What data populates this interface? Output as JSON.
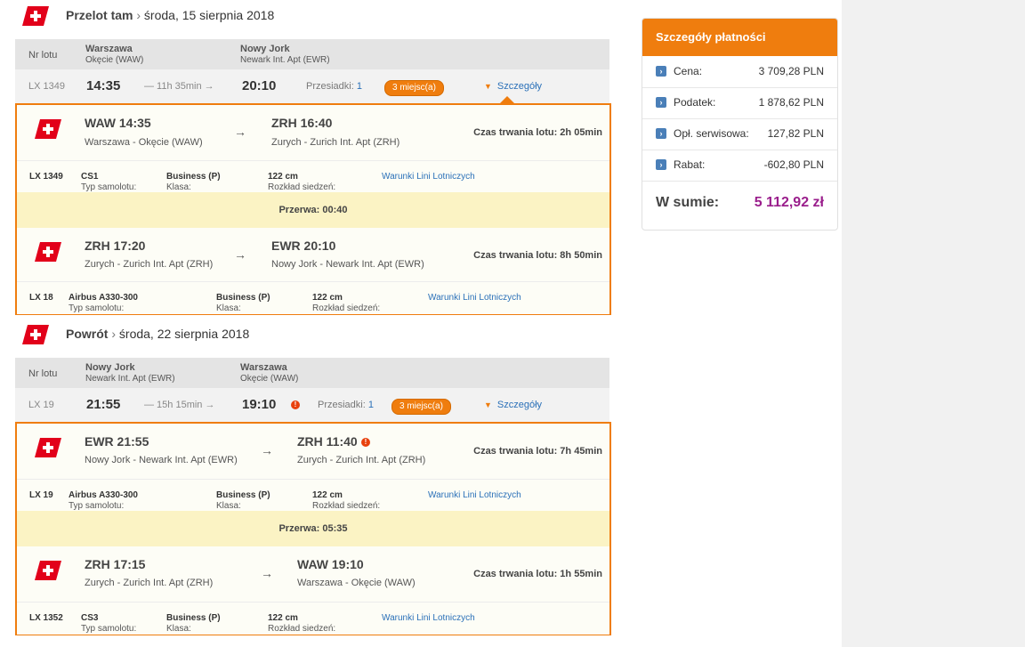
{
  "colors": {
    "accent": "#ef7d0e",
    "link": "#2a70b8",
    "total": "#9a1e8c",
    "break_bg": "#fbf3c4"
  },
  "outbound": {
    "heading": "Przelot tam",
    "date": "środa, 15 sierpnia 2018",
    "table_head": {
      "nr": "Nr lotu",
      "from_city": "Warszawa",
      "from_apt": "Okęcie (WAW)",
      "to_city": "Nowy Jork",
      "to_apt": "Newark Int. Apt (EWR)"
    },
    "summary": {
      "flight": "LX 1349",
      "dep": "14:35",
      "duration": "— 11h 35min →",
      "arr": "20:10",
      "transfers_label": "Przesiadki:",
      "transfers": "1",
      "seats": "3 miejsc(a)",
      "details": "Szczegóły"
    },
    "legs": [
      {
        "from_code": "WAW 14:35",
        "from_place": "Warszawa - Okęcie (WAW)",
        "to_code": "ZRH 16:40",
        "to_place": "Zurych - Zurich Int. Apt (ZRH)",
        "duration": "Czas trwania lotu: 2h 05min",
        "flight": "LX 1349",
        "plane_label": "Typ samolotu:",
        "plane": "CS1",
        "class_label": "Klasa:",
        "class": "Business (P)",
        "seat_label": "Rozkład siedzeń:",
        "seat": "122 cm",
        "terms": "Warunki Lini Lotniczych"
      },
      {
        "from_code": "ZRH 17:20",
        "from_place": "Zurych - Zurich Int. Apt (ZRH)",
        "to_code": "EWR 20:10",
        "to_place": "Nowy Jork - Newark Int. Apt (EWR)",
        "duration": "Czas trwania lotu: 8h 50min",
        "flight": "LX 18",
        "plane_label": "Typ samolotu:",
        "plane": "Airbus A330-300",
        "class_label": "Klasa:",
        "class": "Business (P)",
        "seat_label": "Rozkład siedzeń:",
        "seat": "122 cm",
        "terms": "Warunki Lini Lotniczych"
      }
    ],
    "break": "Przerwa: 00:40"
  },
  "return": {
    "heading": "Powrót",
    "date": "środa, 22 sierpnia 2018",
    "table_head": {
      "nr": "Nr lotu",
      "from_city": "Nowy Jork",
      "from_apt": "Newark Int. Apt (EWR)",
      "to_city": "Warszawa",
      "to_apt": "Okęcie (WAW)"
    },
    "summary": {
      "flight": "LX 19",
      "dep": "21:55",
      "duration": "— 15h 15min →",
      "arr": "19:10",
      "transfers_label": "Przesiadki:",
      "transfers": "1",
      "seats": "3 miejsc(a)",
      "details": "Szczegóły"
    },
    "legs": [
      {
        "from_code": "EWR 21:55",
        "from_place": "Nowy Jork - Newark Int. Apt (EWR)",
        "to_code": "ZRH 11:40",
        "to_place": "Zurych - Zurich Int. Apt (ZRH)",
        "duration": "Czas trwania lotu: 7h 45min",
        "flight": "LX 19",
        "plane_label": "Typ samolotu:",
        "plane": "Airbus A330-300",
        "class_label": "Klasa:",
        "class": "Business (P)",
        "seat_label": "Rozkład siedzeń:",
        "seat": "122 cm",
        "terms": "Warunki Lini Lotniczych"
      },
      {
        "from_code": "ZRH 17:15",
        "from_place": "Zurych - Zurich Int. Apt (ZRH)",
        "to_code": "WAW 19:10",
        "to_place": "Warszawa - Okęcie (WAW)",
        "duration": "Czas trwania lotu: 1h 55min",
        "flight": "LX 1352",
        "plane_label": "Typ samolotu:",
        "plane": "CS3",
        "class_label": "Klasa:",
        "class": "Business (P)",
        "seat_label": "Rozkład siedzeń:",
        "seat": "122 cm",
        "terms": "Warunki Lini Lotniczych"
      }
    ],
    "break": "Przerwa: 05:35"
  },
  "payment": {
    "title": "Szczegóły płatności",
    "rows": [
      {
        "label": "Cena:",
        "value": "3 709,28 PLN"
      },
      {
        "label": "Podatek:",
        "value": "1 878,62 PLN"
      },
      {
        "label": "Opł. serwisowa:",
        "value": "127,82 PLN"
      },
      {
        "label": "Rabat:",
        "value": "-602,80 PLN"
      }
    ],
    "total_label": "W sumie:",
    "total_value": "5 112,92 zł"
  }
}
